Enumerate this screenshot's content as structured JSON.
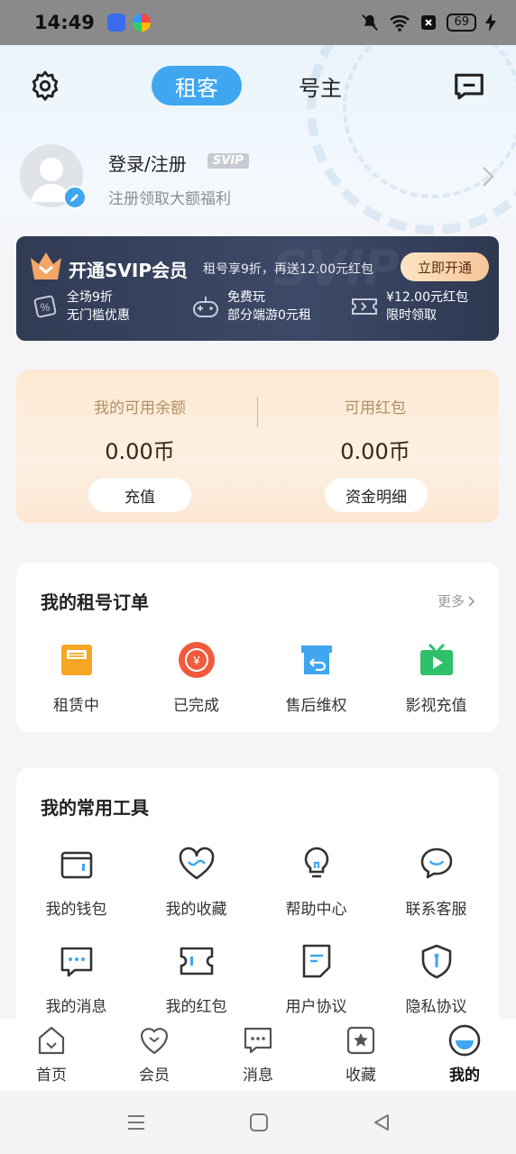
{
  "status_bar": {
    "time": "14:49",
    "battery": "69"
  },
  "header": {
    "tabs": [
      {
        "label": "租客",
        "active": true
      },
      {
        "label": "号主",
        "active": false
      }
    ]
  },
  "profile": {
    "login_label": "登录/注册",
    "tag": "SVIP",
    "subtitle": "注册领取大额福利"
  },
  "svip": {
    "title": "开通SVIP会员",
    "description": "租号享9折，再送12.00元红包",
    "button": "立即开通",
    "watermark": "SVIP",
    "benefits": [
      {
        "line1": "全场9折",
        "line2": "无门槛优惠",
        "icon": "percent-tag-icon"
      },
      {
        "line1": "免费玩",
        "line2": "部分端游0元租",
        "icon": "gamepad-icon"
      },
      {
        "line1": "¥12.00元红包",
        "line2": "限时领取",
        "icon": "ticket-icon"
      }
    ]
  },
  "balance": {
    "available_label": "我的可用余额",
    "available_value": "0.00币",
    "redpacket_label": "可用红包",
    "redpacket_value": "0.00币",
    "recharge_button": "充值",
    "detail_button": "资金明细"
  },
  "orders": {
    "title": "我的租号订单",
    "more": "更多",
    "items": [
      {
        "label": "租赁中",
        "icon": "renting-icon"
      },
      {
        "label": "已完成",
        "icon": "completed-icon"
      },
      {
        "label": "售后维权",
        "icon": "after-sales-icon"
      },
      {
        "label": "影视充值",
        "icon": "tv-recharge-icon"
      }
    ]
  },
  "tools": {
    "title": "我的常用工具",
    "items": [
      {
        "label": "我的钱包",
        "icon": "wallet-icon"
      },
      {
        "label": "我的收藏",
        "icon": "heart-icon"
      },
      {
        "label": "帮助中心",
        "icon": "lightbulb-icon"
      },
      {
        "label": "联系客服",
        "icon": "customer-service-icon"
      },
      {
        "label": "我的消息",
        "icon": "message-icon"
      },
      {
        "label": "我的红包",
        "icon": "coupon-icon"
      },
      {
        "label": "用户协议",
        "icon": "document-icon"
      },
      {
        "label": "隐私协议",
        "icon": "shield-icon"
      }
    ]
  },
  "bottom_nav": {
    "items": [
      {
        "label": "首页",
        "icon": "home-icon"
      },
      {
        "label": "会员",
        "icon": "member-icon"
      },
      {
        "label": "消息",
        "icon": "chat-icon"
      },
      {
        "label": "收藏",
        "icon": "star-icon"
      },
      {
        "label": "我的",
        "icon": "profile-icon",
        "active": true
      }
    ]
  },
  "colors": {
    "accent": "#3fa6ef",
    "orange": "#f5a623",
    "red": "#f25a3c",
    "green": "#2fc06a"
  }
}
